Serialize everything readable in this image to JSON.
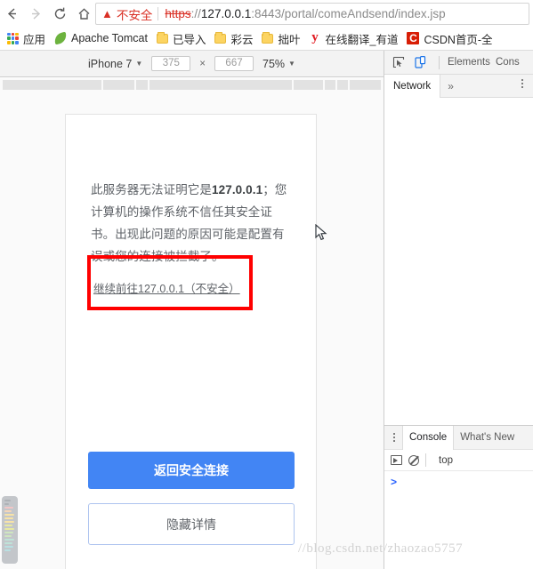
{
  "browser": {
    "nav": {
      "back_icon": "arrow-left-icon",
      "forward_icon": "arrow-right-icon",
      "reload_icon": "reload-icon",
      "home_icon": "home-icon"
    },
    "omnibox": {
      "warning_icon": "warning-triangle-icon",
      "security_label": "不安全",
      "url_scheme": "https",
      "url_separator": "://",
      "url_host": "127.0.0.1",
      "url_rest": ":8443/portal/comeAndsend/index.jsp",
      "full_url": "https://127.0.0.1:8443/portal/comeAndsend/index.jsp"
    },
    "bookmarks": [
      {
        "label": "应用",
        "icon": "apps-grid-icon"
      },
      {
        "label": "Apache Tomcat",
        "icon": "tomcat-leaf-icon"
      },
      {
        "label": "已导入",
        "icon": "folder-icon"
      },
      {
        "label": "彩云",
        "icon": "folder-icon"
      },
      {
        "label": "拙叶",
        "icon": "folder-icon"
      },
      {
        "label": "在线翻译_有道",
        "icon": "youdao-y-icon"
      },
      {
        "label": "CSDN首页-全",
        "icon": "csdn-c-icon"
      }
    ]
  },
  "device_toolbar": {
    "device_name": "iPhone 7",
    "device_caret": "▼",
    "width_value": "375",
    "multiply_symbol": "×",
    "height_value": "667",
    "zoom_value": "75%",
    "zoom_caret": "▼"
  },
  "ssl_page": {
    "body_text_prefix": "此服务器无法证明它是",
    "body_host": "127.0.0.1",
    "body_text_suffix": "；您计算机的操作系统不信任其安全证书。出现此问题的原因可能是配置有误或您的连接被拦截了。",
    "proceed_link": "继续前往127.0.0.1（不安全）",
    "primary_button": "返回安全连接",
    "secondary_button": "隐藏详情",
    "highlight_color": "#ff0000",
    "primary_button_color": "#4285f4"
  },
  "devtools": {
    "inspect_icon": "inspect-cursor-icon",
    "device_toggle_icon": "device-toolbar-icon",
    "tabs": [
      "Elements",
      "Cons"
    ],
    "panel_tab_active": "Network",
    "overflow_symbol": "»",
    "kebab_icon": "more-options-icon",
    "drawer": {
      "kebab_icon": "more-tools-icon",
      "tab_active": "Console",
      "tab_secondary": "What's New",
      "context_icon": "execution-context-icon",
      "clear_icon": "clear-console-icon",
      "context_value": "top",
      "prompt_symbol": ">"
    }
  },
  "watermark": {
    "text": "//blog.csdn.net/zhaozao5757"
  }
}
